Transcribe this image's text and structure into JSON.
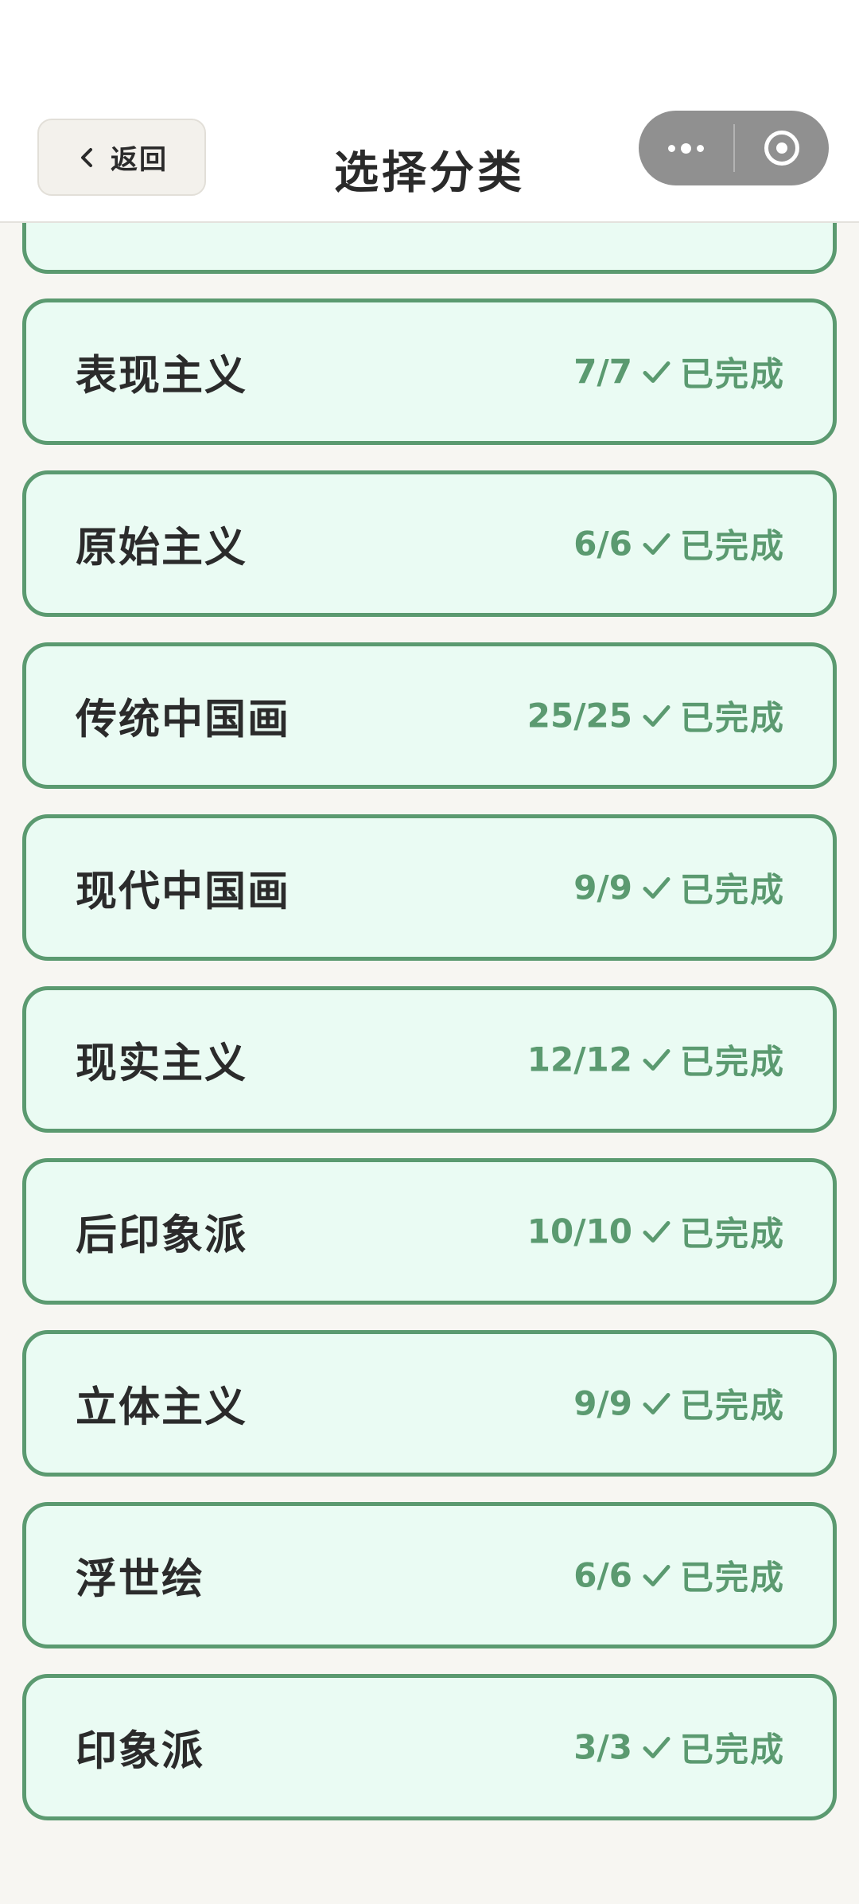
{
  "nav": {
    "back_label": "返回",
    "title": "选择分类"
  },
  "colors": {
    "accent_green": "#5b9a70",
    "card_bg": "#eafbf3",
    "page_bg": "#f7f6f2"
  },
  "categories": [
    {
      "name": "",
      "progress": "",
      "status": ""
    },
    {
      "name": "表现主义",
      "progress": "7/7",
      "status": "已完成"
    },
    {
      "name": "原始主义",
      "progress": "6/6",
      "status": "已完成"
    },
    {
      "name": "传统中国画",
      "progress": "25/25",
      "status": "已完成"
    },
    {
      "name": "现代中国画",
      "progress": "9/9",
      "status": "已完成"
    },
    {
      "name": "现实主义",
      "progress": "12/12",
      "status": "已完成"
    },
    {
      "name": "后印象派",
      "progress": "10/10",
      "status": "已完成"
    },
    {
      "name": "立体主义",
      "progress": "9/9",
      "status": "已完成"
    },
    {
      "name": "浮世绘",
      "progress": "6/6",
      "status": "已完成"
    },
    {
      "name": "印象派",
      "progress": "3/3",
      "status": "已完成"
    }
  ]
}
